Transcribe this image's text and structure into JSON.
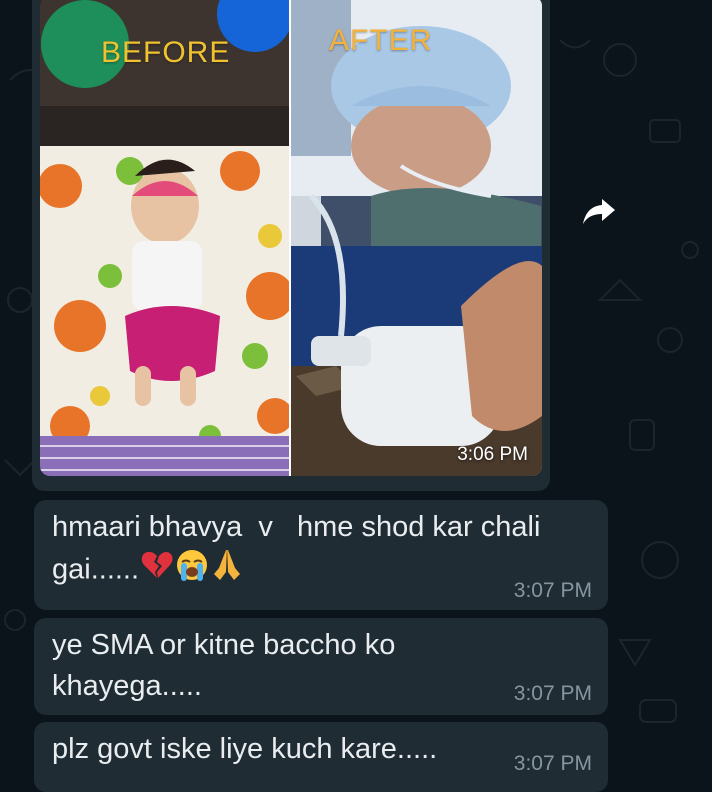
{
  "messages": {
    "image_message": {
      "before_label": "BEFORE",
      "after_label": "AFTER",
      "time": "3:06 PM"
    },
    "msg1": {
      "line1": "hmaari bhavya  v   hme shod kar chali",
      "line2": "gai......",
      "time": "3:07 PM"
    },
    "msg2": {
      "line1": "ye SMA or kitne baccho ko",
      "line2": "khayega.....",
      "time": "3:07 PM"
    },
    "msg3": {
      "line1": "plz govt iske liye kuch kare.....",
      "time": "3:07 PM"
    }
  },
  "icons": {
    "forward": "forward-icon",
    "emojis": [
      "broken-heart-emoji",
      "loudly-crying-face-emoji",
      "folded-hands-emoji"
    ]
  },
  "colors": {
    "background": "#0b141a",
    "bubble": "#1f2c34",
    "text": "#e9edef",
    "timestamp": "#8696a0"
  }
}
